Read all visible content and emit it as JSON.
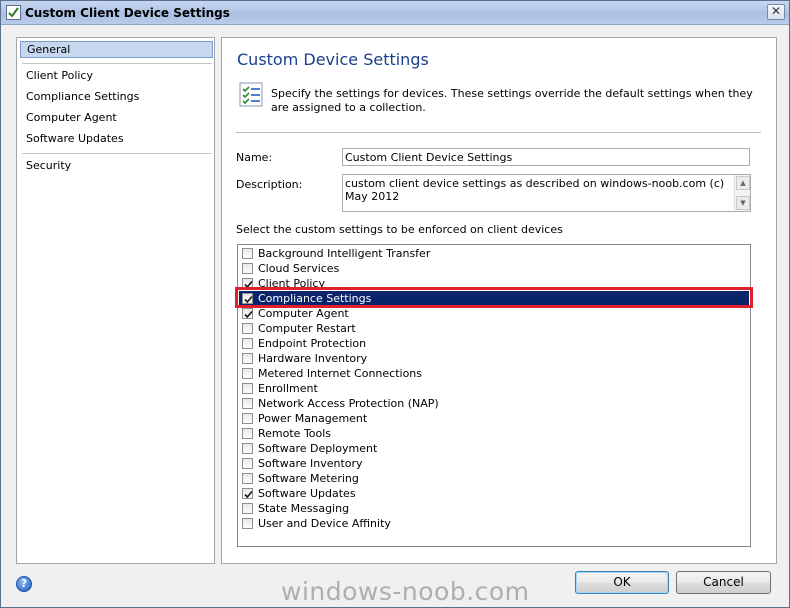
{
  "window": {
    "title": "Custom Client Device Settings",
    "close_glyph": "✕"
  },
  "nav": {
    "items": [
      {
        "label": "General",
        "selected": true
      },
      {
        "label": "Client Policy"
      },
      {
        "label": "Compliance Settings"
      },
      {
        "label": "Computer Agent"
      },
      {
        "label": "Software Updates"
      },
      {
        "label": "Security"
      }
    ]
  },
  "main": {
    "title": "Custom Device Settings",
    "description": "Specify the settings for devices. These settings override the default settings when they are assigned to a collection.",
    "name_label": "Name:",
    "name_value": "Custom Client Device Settings",
    "description_label": "Description:",
    "description_value": "custom client device settings as described on windows-noob.com (c) May 2012",
    "list_label": "Select the custom settings to be enforced on client devices",
    "settings": [
      {
        "label": "Background Intelligent Transfer",
        "checked": false
      },
      {
        "label": "Cloud Services",
        "checked": false
      },
      {
        "label": "Client Policy",
        "checked": true
      },
      {
        "label": "Compliance Settings",
        "checked": true,
        "selected": true
      },
      {
        "label": "Computer Agent",
        "checked": true
      },
      {
        "label": "Computer Restart",
        "checked": false
      },
      {
        "label": "Endpoint Protection",
        "checked": false
      },
      {
        "label": "Hardware Inventory",
        "checked": false
      },
      {
        "label": "Metered Internet Connections",
        "checked": false
      },
      {
        "label": "Enrollment",
        "checked": false
      },
      {
        "label": "Network Access Protection (NAP)",
        "checked": false
      },
      {
        "label": "Power Management",
        "checked": false
      },
      {
        "label": "Remote Tools",
        "checked": false
      },
      {
        "label": "Software Deployment",
        "checked": false
      },
      {
        "label": "Software Inventory",
        "checked": false
      },
      {
        "label": "Software Metering",
        "checked": false
      },
      {
        "label": "Software Updates",
        "checked": true
      },
      {
        "label": "State Messaging",
        "checked": false
      },
      {
        "label": "User and Device Affinity",
        "checked": false
      }
    ]
  },
  "footer": {
    "help_glyph": "?",
    "ok_label": "OK",
    "cancel_label": "Cancel"
  },
  "watermark": "windows-noob.com",
  "colors": {
    "title_blue": "#1c3f8c",
    "selection": "#0a246a",
    "highlight_red": "#e0202a"
  }
}
